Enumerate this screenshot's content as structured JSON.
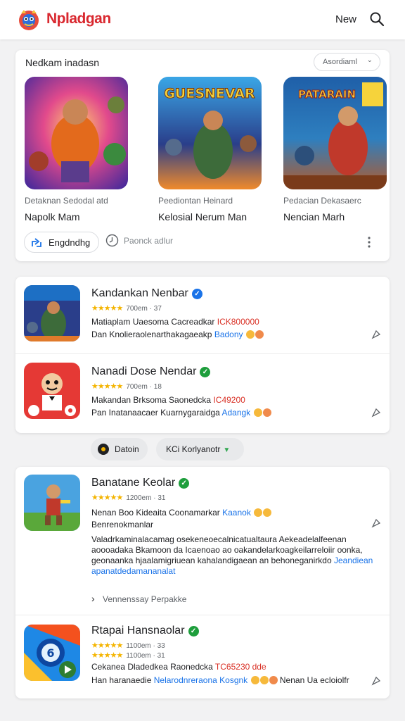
{
  "header": {
    "brand": "Npladgan",
    "new_label": "New"
  },
  "featured": {
    "title": "Nedkam inadasn",
    "filter": "Asordiaml",
    "tiles": [
      {
        "sub": "Detaknan Sedodal atd",
        "name": "Napolk Mam"
      },
      {
        "sub": "Peediontan Heinard",
        "name": "Kelosial Nerum Man",
        "art_text": "GUESNEVAR"
      },
      {
        "sub": "Pedacian Dekasaerc",
        "name": "Nencian Marh",
        "art_text": "PATARAIN"
      }
    ],
    "primary_button": "Engdndhg",
    "secondary_label": "Paonck adlur"
  },
  "list1": [
    {
      "name": "Kandankan Nenbar",
      "verify": "blue",
      "rating_meta": "700em · 37",
      "line1": "Matiaplam Uaesoma Cacreadkar",
      "line1_accent": "ICK800000",
      "line2": "Dan Knolieraolenarthakagaeakp",
      "line2_link": "Badony"
    },
    {
      "name": "Nanadi Dose Nendar",
      "verify": "green",
      "rating_meta": "700em · 18",
      "line1": "Makandan Brksoma Saonedcka",
      "line1_accent": "IC49200",
      "line2": "Pan Inatanaacaer Kuarnygaraidga",
      "line2_link": "Adangk"
    }
  ],
  "chips": {
    "a": "Datoin",
    "b": "KCi Korlyanotr"
  },
  "list2": [
    {
      "name": "Banatane Keolar",
      "verify": "green",
      "rating_meta": "1200em · 31",
      "line1": "Nenan Boo Kideaita Coonamarkar",
      "line1_link": "Kaanok",
      "line2": "Benrenokmanlar",
      "paragraph": "Valadrkaminalacamag osekeneoecalnicatualtaura Aekeadelalfeenan aoooadaka Bkamoon da Icaenoao ao oakandelarkoagkeilarreloiir oonka, geonaanka hjaalamigriuean kahalandigaean an behoneganirkdo",
      "paragraph_link": "Jeandiean",
      "paragraph_last": "apanatdedamananalat",
      "more": "Vennenssay Perpakke"
    },
    {
      "name": "Rtapai Hansnaolar",
      "verify": "green",
      "rating_meta": "1100em · 33",
      "rating_meta_2": "1100em · 31",
      "line1": "Cekanea Dladedkea Raonedcka",
      "line1_accent": "TC65230 dde",
      "line2": "Han haranaedie",
      "line2_link": "Nelarodnreraona",
      "line2_link_b": "Kosgnk",
      "line2_tail": "Nenan Ua ecloiolfr"
    }
  ],
  "colors": {
    "brand": "#d9282f",
    "link": "#1a73e8",
    "star": "#f4b400",
    "verify_blue": "#1a73e8",
    "verify_green": "#1e9e3c"
  }
}
